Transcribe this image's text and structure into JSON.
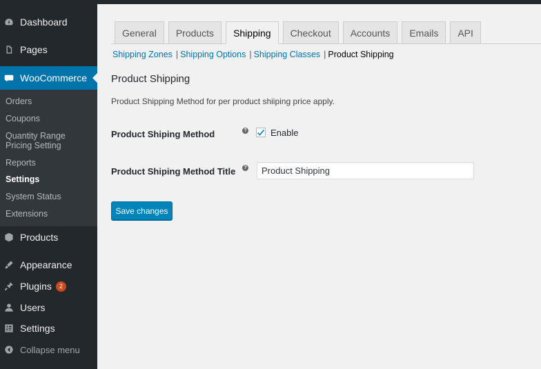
{
  "sidebar": {
    "menu": [
      {
        "label": "Dashboard",
        "icon": "dashboard-icon"
      },
      {
        "label": "Pages",
        "icon": "pages-icon"
      },
      {
        "label": "WooCommerce",
        "icon": "woocommerce-icon"
      },
      {
        "label": "Products",
        "icon": "products-icon"
      },
      {
        "label": "Appearance",
        "icon": "appearance-icon"
      },
      {
        "label": "Plugins",
        "icon": "plugins-icon",
        "badge": "2"
      },
      {
        "label": "Users",
        "icon": "users-icon"
      },
      {
        "label": "Settings",
        "icon": "settings-icon"
      },
      {
        "label": "Collapse menu",
        "icon": "collapse-icon"
      }
    ],
    "submenu": [
      {
        "label": "Orders"
      },
      {
        "label": "Coupons"
      },
      {
        "label": "Quantity Range Pricing Setting"
      },
      {
        "label": "Reports"
      },
      {
        "label": "Settings",
        "current": true
      },
      {
        "label": "System Status"
      },
      {
        "label": "Extensions"
      }
    ]
  },
  "tabs": [
    {
      "label": "General"
    },
    {
      "label": "Products"
    },
    {
      "label": "Shipping",
      "active": true
    },
    {
      "label": "Checkout"
    },
    {
      "label": "Accounts"
    },
    {
      "label": "Emails"
    },
    {
      "label": "API"
    }
  ],
  "subnav": {
    "items": [
      "Shipping Zones",
      "Shipping Options",
      "Shipping Classes"
    ],
    "current": "Product Shipping",
    "separator": "|"
  },
  "section": {
    "title": "Product Shipping",
    "description": "Product Shipping Method for per product shiiping price apply."
  },
  "fields": {
    "method": {
      "label": "Product Shiping Method",
      "checkbox_label": "Enable",
      "checked": true
    },
    "title": {
      "label": "Product Shiping Method Title",
      "value": "Product Shipping"
    },
    "help_glyph": "?"
  },
  "save_button": "Save changes",
  "colors": {
    "accent": "#0073aa",
    "sidebar": "#23282d",
    "badge": "#ca4a1f"
  }
}
